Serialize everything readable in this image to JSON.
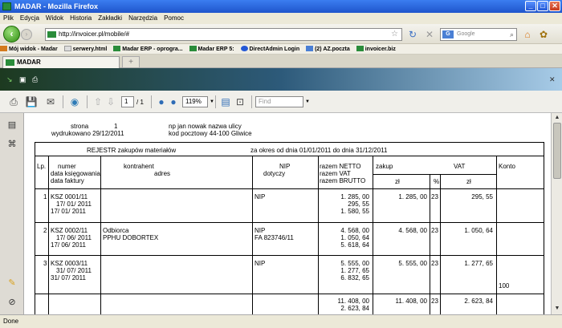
{
  "window": {
    "title": "MADAR - Mozilla Firefox",
    "min": "_",
    "max": "□",
    "close": "✕"
  },
  "menu": [
    "Plik",
    "Edycja",
    "Widok",
    "Historia",
    "Zakładki",
    "Narzędzia",
    "Pomoc"
  ],
  "nav": {
    "url": "http://invoicer.pl/mobile/#",
    "search_placeholder": "Google",
    "back": "‹",
    "forward": "›"
  },
  "bookmarks": [
    "Mój widok - Madar",
    "serwery.html",
    "Madar ERP - oprogra...",
    "Madar ERP 5:",
    "DirectAdmin Login",
    "(2) AZ.poczta",
    "invoicer.biz"
  ],
  "tab": {
    "label": "MADAR",
    "new": "+"
  },
  "pdf": {
    "page_current": "1",
    "page_total": "/ 1",
    "zoom": "119%",
    "find_placeholder": "Find"
  },
  "status": "Done",
  "doc": {
    "strona_label": "strona",
    "strona_value": "1",
    "printed": "wydrukowano 29/12/2011",
    "addr1": "np jan nowak nazwa ulicy",
    "addr2": "kod pocztowy 44-100 Gliwice",
    "title": "REJESTR zakupów materiałów",
    "period": "za okres od dnia 01/01/2011 do dnia 31/12/2011",
    "h_lp": "Lp.",
    "h_numer": "numer",
    "h_data_ks": "data księgowania",
    "h_data_f": "data faktury",
    "h_kontr": "kontrahent",
    "h_adres": "adres",
    "h_nip": "NIP",
    "h_dotyczy": "dotyczy",
    "h_netto": "razem NETTO",
    "h_vat": "razem VAT",
    "h_brutto": "razem BRUTTO",
    "h_zakup": "zakup",
    "h_zl": "zł",
    "h_vatcol": "VAT",
    "h_pct": "%",
    "h_zl2": "zł",
    "h_konto": "Konto",
    "rows": [
      {
        "lp": "1",
        "num": "KSZ 0001/11",
        "d1": "17/ 01/ 2011",
        "d2": "17/ 01/ 2011",
        "k1": "",
        "k2": "",
        "nip": "NIP",
        "nip2": "",
        "n": "1. 285, 00",
        "v": "295, 55",
        "b": "1. 580, 55",
        "z": "1. 285, 00",
        "pct": "23",
        "vz": "295, 55",
        "konto": ""
      },
      {
        "lp": "2",
        "num": "KSZ 0002/11",
        "d1": "17/ 06/ 2011",
        "d2": "17/ 06/ 2011",
        "k1": "Odbiorca",
        "k2": "PPHU DOBORTEX",
        "nip": "NIP",
        "nip2": "FA 823746/11",
        "n": "4. 568, 00",
        "v": "1. 050, 64",
        "b": "5. 618, 64",
        "z": "4. 568, 00",
        "pct": "23",
        "vz": "1. 050, 64",
        "konto": ""
      },
      {
        "lp": "3",
        "num": "KSZ 0003/11",
        "d1": "31/ 07/ 2011",
        "d2": "31/ 07/ 2011",
        "k1": "",
        "k2": "",
        "nip": "NIP",
        "nip2": "",
        "n": "5. 555, 00",
        "v": "1. 277, 65",
        "b": "6. 832, 65",
        "z": "5. 555, 00",
        "pct": "23",
        "vz": "1. 277, 65",
        "konto": "100"
      }
    ],
    "total": {
      "n": "11. 408, 00",
      "v": "2. 623, 84",
      "z": "11. 408, 00",
      "pct": "23",
      "vz": "2. 623, 84"
    }
  }
}
